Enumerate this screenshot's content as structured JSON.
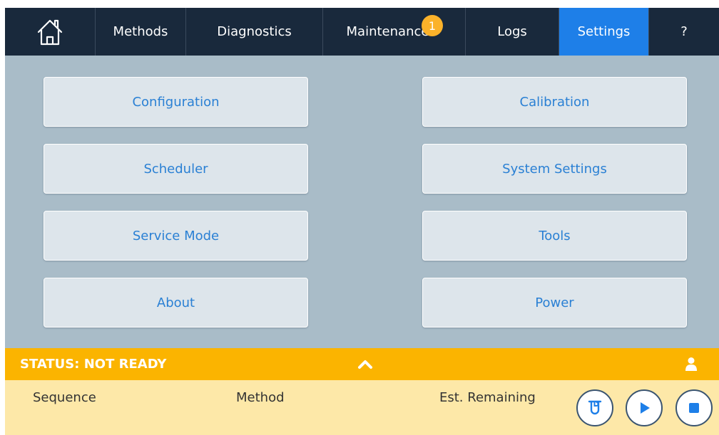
{
  "nav": {
    "home_icon": "home-icon",
    "tabs": [
      {
        "label": "Methods"
      },
      {
        "label": "Diagnostics"
      },
      {
        "label": "Maintenance",
        "badge": "1"
      },
      {
        "label": "Logs"
      },
      {
        "label": "Settings",
        "active": true
      },
      {
        "label": "?"
      }
    ]
  },
  "settings_menu": {
    "left": [
      "Configuration",
      "Scheduler",
      "Service Mode",
      "About"
    ],
    "right": [
      "Calibration",
      "System Settings",
      "Tools",
      "Power"
    ]
  },
  "status": {
    "text": "STATUS: NOT READY",
    "expand_icon": "chevron-up-icon",
    "user_icon": "user-icon"
  },
  "run_panel": {
    "sequence_label": "Sequence",
    "method_label": "Method",
    "remaining_label": "Est. Remaining",
    "buttons": [
      "vial-icon",
      "play-icon",
      "stop-icon"
    ]
  },
  "colors": {
    "nav_bg": "#19293c",
    "active_tab": "#1e7fe8",
    "badge": "#fbb22a",
    "main_bg": "#a9bcc8",
    "tile_bg": "#dde5eb",
    "tile_text": "#2a80d4",
    "status_bg": "#fbb400",
    "panel_bg": "#fde8a8",
    "button_accent": "#1e7fe8"
  }
}
